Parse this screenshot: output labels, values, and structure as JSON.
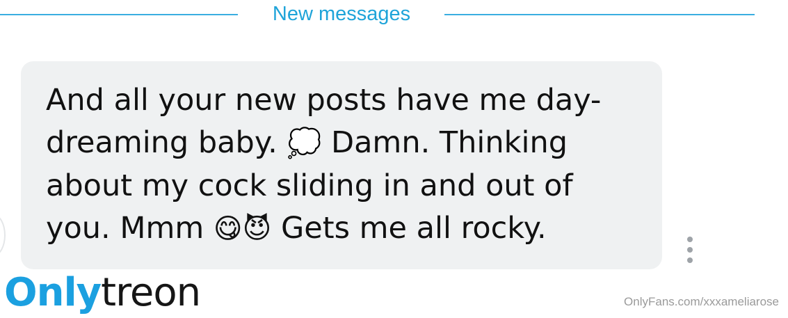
{
  "divider": {
    "label": "New messages",
    "color": "#1fa4d9"
  },
  "message": {
    "text_part1": "And all your new posts have me day-dreaming baby. ",
    "emoji_cloud": "💭",
    "text_part2": " Damn. Thinking about my cock sliding in and out of you. Mmm ",
    "emoji_yum": "😋",
    "emoji_devil": "😈",
    "text_part3": " Gets me all rocky.",
    "bubble_color": "#eff1f2"
  },
  "menu": {
    "icon": "more-vertical-icon"
  },
  "watermark": {
    "logo_part1": "Only",
    "logo_part2": "treon",
    "logo_accent": "#1ba0e0",
    "handle": "OnlyFans.com/xxxameliarose"
  }
}
